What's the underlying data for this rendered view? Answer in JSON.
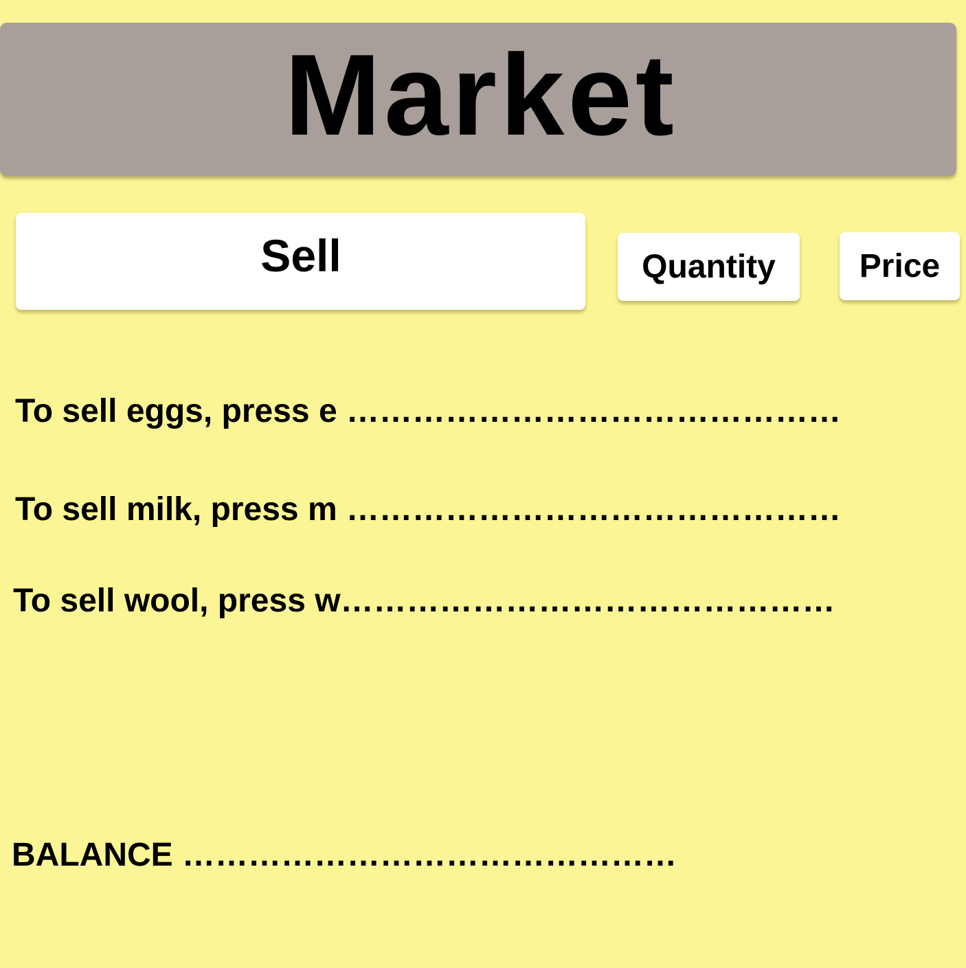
{
  "header": {
    "title": "Market"
  },
  "tabs": {
    "sell_label": "Sell",
    "quantity_label": "Quantity",
    "price_label": "Price"
  },
  "instructions": [
    {
      "text": "To sell eggs, press e ………………………………………"
    },
    {
      "text": "To sell milk, press m ………………………………………"
    },
    {
      "text": "To sell wool, press w………………………………………"
    }
  ],
  "balance": {
    "text": "BALANCE ………………………………………"
  },
  "colors": {
    "background": "#fbf595",
    "header": "#a89f9a",
    "card": "#ffffff"
  }
}
